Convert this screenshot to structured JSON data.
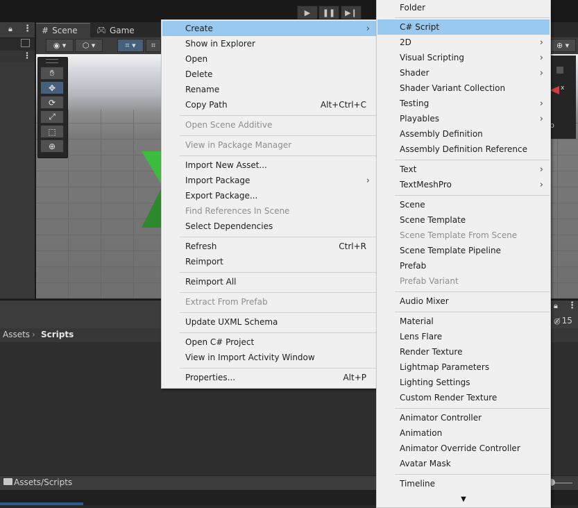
{
  "scene_view": {
    "scene_tab": "Scene",
    "game_tab": "Game"
  },
  "project": {
    "breadcrumb_root": "Assets",
    "breadcrumb_current": "Scripts",
    "footer_path": "Assets/Scripts",
    "hidden_count": "15"
  },
  "context_menu": [
    {
      "label": "Create",
      "submenu": true,
      "highlighted": true
    },
    {
      "label": "Show in Explorer"
    },
    {
      "label": "Open"
    },
    {
      "label": "Delete"
    },
    {
      "label": "Rename"
    },
    {
      "label": "Copy Path",
      "shortcut": "Alt+Ctrl+C"
    },
    {
      "label": "Open Scene Additive",
      "disabled": true
    },
    {
      "label": "View in Package Manager",
      "disabled": true
    },
    {
      "label": "Import New Asset..."
    },
    {
      "label": "Import Package",
      "submenu": true
    },
    {
      "label": "Export Package..."
    },
    {
      "label": "Find References In Scene",
      "disabled": true
    },
    {
      "label": "Select Dependencies"
    },
    {
      "label": "Refresh",
      "shortcut": "Ctrl+R"
    },
    {
      "label": "Reimport"
    },
    {
      "label": "Reimport All"
    },
    {
      "label": "Extract From Prefab",
      "disabled": true
    },
    {
      "label": "Update UXML Schema"
    },
    {
      "label": "Open C# Project"
    },
    {
      "label": "View in Import Activity Window"
    },
    {
      "label": "Properties...",
      "shortcut": "Alt+P"
    }
  ],
  "create_submenu": [
    {
      "label": "Folder"
    },
    {
      "label": "C# Script",
      "highlighted": true
    },
    {
      "label": "2D",
      "submenu": true
    },
    {
      "label": "Visual Scripting",
      "submenu": true
    },
    {
      "label": "Shader",
      "submenu": true
    },
    {
      "label": "Shader Variant Collection"
    },
    {
      "label": "Testing",
      "submenu": true
    },
    {
      "label": "Playables",
      "submenu": true
    },
    {
      "label": "Assembly Definition"
    },
    {
      "label": "Assembly Definition Reference"
    },
    {
      "label": "Text",
      "submenu": true
    },
    {
      "label": "TextMeshPro",
      "submenu": true
    },
    {
      "label": "Scene"
    },
    {
      "label": "Scene Template"
    },
    {
      "label": "Scene Template From Scene",
      "disabled": true
    },
    {
      "label": "Scene Template Pipeline"
    },
    {
      "label": "Prefab"
    },
    {
      "label": "Prefab Variant",
      "disabled": true
    },
    {
      "label": "Audio Mixer"
    },
    {
      "label": "Material"
    },
    {
      "label": "Lens Flare"
    },
    {
      "label": "Render Texture"
    },
    {
      "label": "Lightmap Parameters"
    },
    {
      "label": "Lighting Settings"
    },
    {
      "label": "Custom Render Texture"
    },
    {
      "label": "Animator Controller"
    },
    {
      "label": "Animation"
    },
    {
      "label": "Animator Override Controller"
    },
    {
      "label": "Avatar Mask"
    },
    {
      "label": "Timeline"
    }
  ],
  "icons": {
    "play": "play-icon",
    "pause": "pause-icon",
    "step": "step-icon",
    "lock": "lock-icon",
    "more": "kebab-menu-icon",
    "hand": "hand-tool-icon",
    "move": "move-tool-icon",
    "rotate": "rotate-tool-icon",
    "scale": "scale-tool-icon",
    "rect": "rect-tool-icon",
    "transform": "transform-tool-icon",
    "folder": "folder-icon",
    "eye_hidden": "hidden-eye-icon",
    "scroll_down": "scroll-down-icon"
  },
  "colors": {
    "menu_bg": "#f0f0f0",
    "menu_highlight": "#99c9ef",
    "editor_dark": "#282828",
    "panel": "#3c3c3c",
    "cube_green": "#3cbc3c"
  }
}
